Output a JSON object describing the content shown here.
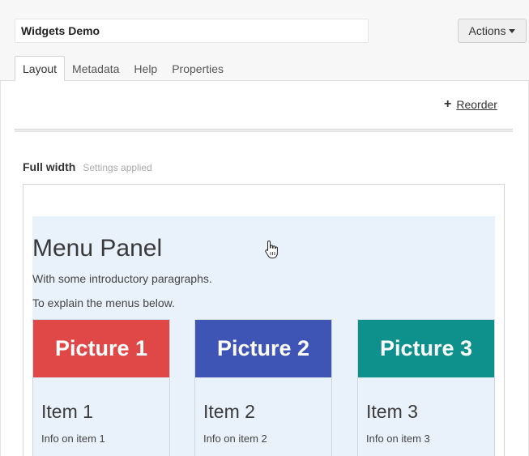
{
  "header": {
    "title_value": "Widgets Demo",
    "actions_label": "Actions"
  },
  "tabs": [
    {
      "label": "Layout",
      "active": true
    },
    {
      "label": "Metadata",
      "active": false
    },
    {
      "label": "Help",
      "active": false
    },
    {
      "label": "Properties",
      "active": false
    }
  ],
  "toolbar": {
    "reorder_label": "Reorder",
    "reorder_icon": "plus-icon"
  },
  "section": {
    "name": "Full width",
    "hint": "Settings applied"
  },
  "panel": {
    "title": "Menu Panel",
    "paragraph1": "With some introductory paragraphs.",
    "paragraph2": "To explain the menus below."
  },
  "cards": [
    {
      "picture_label": "Picture 1",
      "color": "#e04848",
      "title": "Item 1",
      "info": "Info on item 1"
    },
    {
      "picture_label": "Picture 2",
      "color": "#3f55b5",
      "title": "Item 2",
      "info": "Info on item 2"
    },
    {
      "picture_label": "Picture 3",
      "color": "#0e918c",
      "title": "Item 3",
      "info": "Info on item 3"
    }
  ],
  "colors": {
    "panel_bg": "#e9f2fb",
    "topbar_bg": "#f7f7f7"
  }
}
